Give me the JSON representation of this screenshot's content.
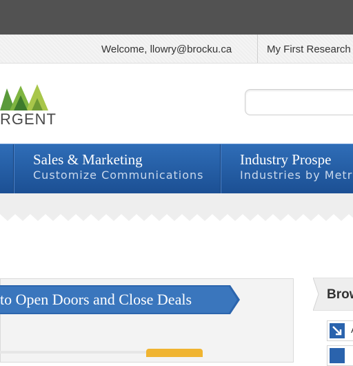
{
  "header": {
    "welcome_text": "Welcome, llowry@brocku.ca",
    "account_link": "My First Research"
  },
  "logo": {
    "text": "RGENT"
  },
  "search": {
    "placeholder": ""
  },
  "nav": {
    "items": [
      {
        "title": "Sales & Marketing",
        "subtitle": "Customize Communications"
      },
      {
        "title": "Industry Prospe",
        "subtitle": "Industries by Metr"
      }
    ]
  },
  "main": {
    "ribbon_text": "to Open Doors and Close Deals"
  },
  "browse": {
    "title": "Brow",
    "items": [
      {
        "label": "A",
        "icon": "arrow-down-right-icon"
      },
      {
        "label": "",
        "icon": "arrow-down-right-icon"
      }
    ]
  },
  "colors": {
    "nav_blue": "#2a63ad",
    "accent_gold": "#f0b431",
    "logo_green": "#6aa33a"
  }
}
